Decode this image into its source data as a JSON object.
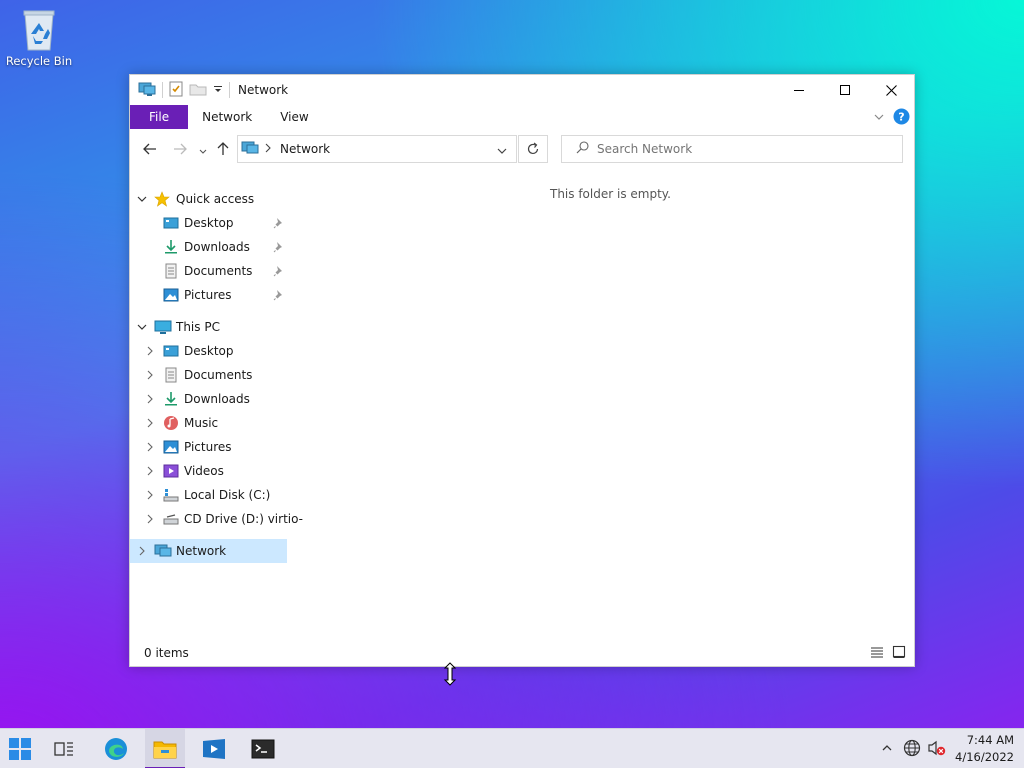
{
  "desktop": {
    "recycle_bin_label": "Recycle Bin"
  },
  "window": {
    "title": "Network",
    "ribbon_tabs": {
      "file": "File",
      "network": "Network",
      "view": "View"
    },
    "address": {
      "segment": "Network"
    },
    "search": {
      "placeholder": "Search Network"
    },
    "empty_message": "This folder is empty.",
    "status": "0 items"
  },
  "nav": {
    "quick_access": {
      "label": "Quick access",
      "items": [
        {
          "label": "Desktop",
          "icon": "desktop-icon"
        },
        {
          "label": "Downloads",
          "icon": "downloads-icon"
        },
        {
          "label": "Documents",
          "icon": "documents-icon"
        },
        {
          "label": "Pictures",
          "icon": "pictures-icon"
        }
      ]
    },
    "this_pc": {
      "label": "This PC",
      "items": [
        {
          "label": "Desktop",
          "icon": "desktop-icon"
        },
        {
          "label": "Documents",
          "icon": "documents-icon"
        },
        {
          "label": "Downloads",
          "icon": "downloads-icon"
        },
        {
          "label": "Music",
          "icon": "music-icon"
        },
        {
          "label": "Pictures",
          "icon": "pictures-icon"
        },
        {
          "label": "Videos",
          "icon": "videos-icon"
        },
        {
          "label": "Local Disk (C:)",
          "icon": "local-disk-icon"
        },
        {
          "label": "CD Drive (D:) virtio-",
          "icon": "cd-drive-icon"
        }
      ]
    },
    "network": {
      "label": "Network",
      "selected": true
    }
  },
  "taskbar": {
    "clock": {
      "time": "7:44 AM",
      "date": "4/16/2022"
    }
  },
  "colors": {
    "accent": "#6a1fb6",
    "selection": "#cce8ff",
    "help": "#1e88e5"
  }
}
